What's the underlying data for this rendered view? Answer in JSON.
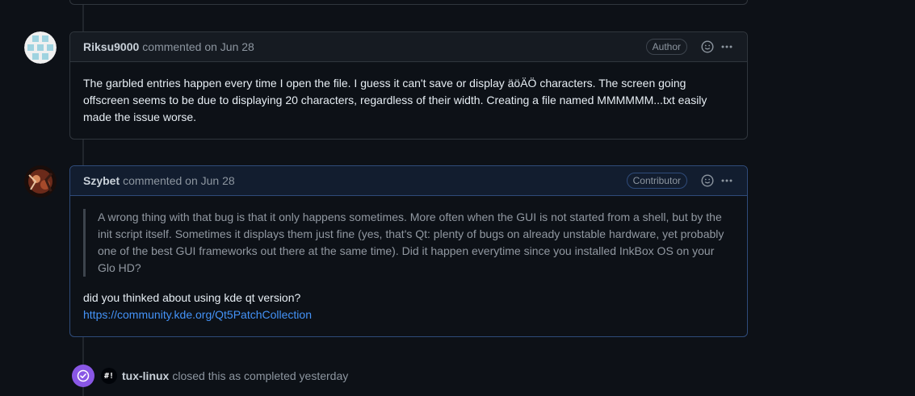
{
  "comments": [
    {
      "author": "Riksu9000",
      "meta": "commented on Jun 28",
      "badge": "Author",
      "body": "The garbled entries happen every time I open the file. I guess it can't save or display äöÄÖ characters. The screen going offscreen seems to be due to displaying 20 characters, regardless of their width. Creating a file named MMMMMM...txt easily made the issue worse."
    },
    {
      "author": "Szybet",
      "meta": "commented on Jun 28",
      "badge": "Contributor",
      "quote": "A wrong thing with that bug is that it only happens sometimes. More often when the GUI is not started from a shell, but by the init script itself. Sometimes it displays them just fine (yes, that's Qt: plenty of bugs on already unstable hardware, yet probably one of the best GUI frameworks out there at the same time). Did it happen everytime since you installed InkBox OS on your Glo HD?",
      "body": "did you thinked about using kde qt version?",
      "link": "https://community.kde.org/Qt5PatchCollection"
    }
  ],
  "event": {
    "actor_initials": "#!",
    "actor": "tux-linux",
    "text": "closed this as completed yesterday"
  },
  "colors": {
    "accent_link": "#4493f8",
    "closed_badge": "#8957e5",
    "background": "#0d1117"
  }
}
